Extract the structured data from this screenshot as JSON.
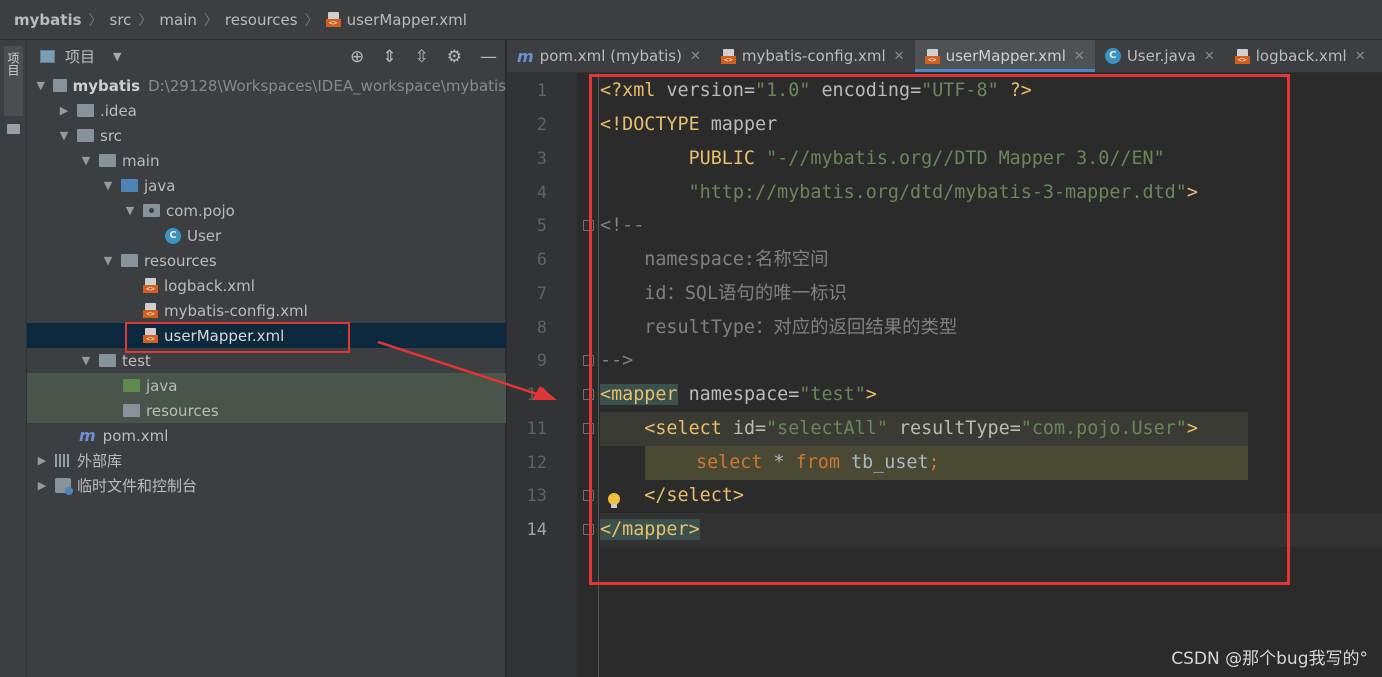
{
  "breadcrumb": {
    "items": [
      "mybatis",
      "src",
      "main",
      "resources",
      "userMapper.xml"
    ]
  },
  "toolstrip": {
    "project_label": "项目"
  },
  "project_panel": {
    "title": "项目",
    "tree": [
      {
        "label": "mybatis",
        "path": "D:\\29128\\Workspaces\\IDEA_workspace\\mybatis"
      },
      {
        "label": ".idea"
      },
      {
        "label": "src"
      },
      {
        "label": "main"
      },
      {
        "label": "java"
      },
      {
        "label": "com.pojo"
      },
      {
        "label": "User"
      },
      {
        "label": "resources"
      },
      {
        "label": "logback.xml"
      },
      {
        "label": "mybatis-config.xml"
      },
      {
        "label": "userMapper.xml"
      },
      {
        "label": "test"
      },
      {
        "label": "java"
      },
      {
        "label": "resources"
      },
      {
        "label": "pom.xml"
      },
      {
        "label": "外部库"
      },
      {
        "label": "临时文件和控制台"
      }
    ]
  },
  "tabs": [
    {
      "label": "pom.xml (mybatis)",
      "icon": "maven-icon"
    },
    {
      "label": "mybatis-config.xml",
      "icon": "xml-icon"
    },
    {
      "label": "userMapper.xml",
      "icon": "xml-icon",
      "active": true
    },
    {
      "label": "User.java",
      "icon": "class-icon"
    },
    {
      "label": "logback.xml",
      "icon": "xml-icon"
    }
  ],
  "editor": {
    "line_numbers": [
      "1",
      "2",
      "3",
      "4",
      "5",
      "6",
      "7",
      "8",
      "9",
      "10",
      "11",
      "12",
      "13",
      "14"
    ],
    "code": {
      "l1": {
        "a": "<?xml ",
        "b": "version",
        "c": "=",
        "d": "\"1.0\"",
        "e": " encoding",
        "f": "=",
        "g": "\"UTF-8\"",
        "h": " ?>"
      },
      "l2": {
        "a": "<!DOCTYPE ",
        "b": "mapper"
      },
      "l3": {
        "a": "        PUBLIC ",
        "b": "\"-//mybatis.org//DTD Mapper 3.0//EN\""
      },
      "l4": {
        "a": "        ",
        "b": "\"http://mybatis.org/dtd/mybatis-3-mapper.dtd\"",
        "c": ">"
      },
      "l5": "<!--",
      "l6": "    namespace:名称空间",
      "l7": "    id：SQL语句的唯一标识",
      "l8": "    resultType：对应的返回结果的类型",
      "l9": "-->",
      "l10": {
        "a": "<mapper",
        "b": " namespace",
        "c": "=",
        "d": "\"test\"",
        "e": ">"
      },
      "l11": {
        "a": "    <select",
        "b": " id",
        "c": "=",
        "d": "\"selectAll\"",
        "e": " resultType",
        "f": "=",
        "g": "\"com.pojo.User\"",
        "h": ">"
      },
      "l12": {
        "a": "select",
        "b": " * ",
        "c": "from",
        "d": " tb_uset",
        "e": ";"
      },
      "l13": {
        "a": "    </select>"
      },
      "l14": {
        "a": "</mapper>"
      }
    }
  },
  "watermark": "CSDN @那个bug我写的°",
  "colors": {
    "annotation": "#e23535",
    "tag": "#e8bf6a",
    "string": "#6a8759",
    "keyword": "#cc7832",
    "comment": "#808080"
  }
}
